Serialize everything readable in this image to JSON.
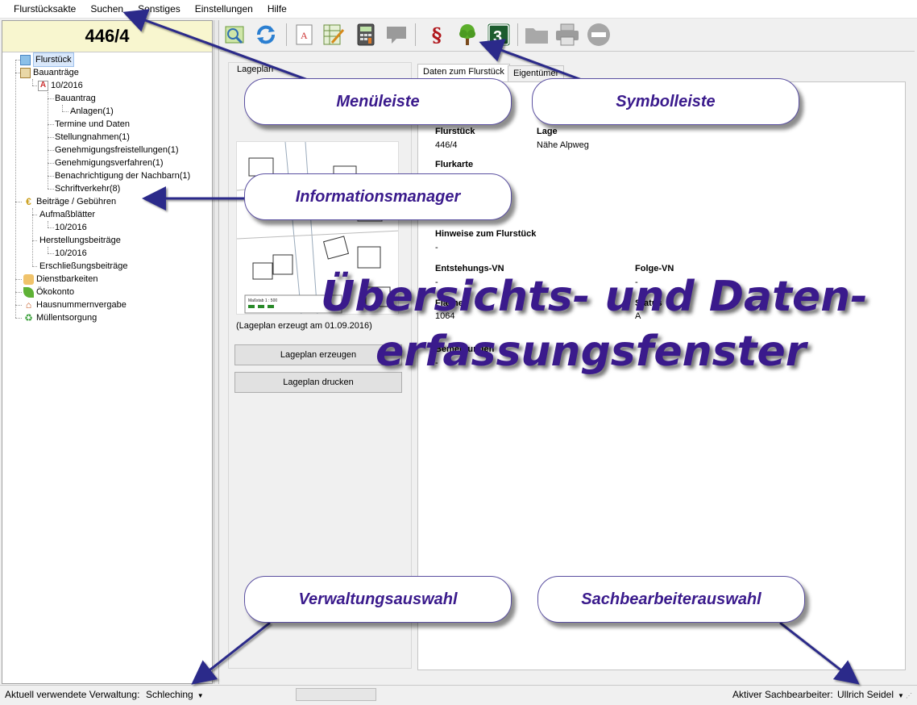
{
  "menu": [
    "Flurstücksakte",
    "Suchen",
    "Sonstiges",
    "Einstellungen",
    "Hilfe"
  ],
  "parcel_number": "446/4",
  "tree": {
    "flurstueck": "Flurstück",
    "bauantraege": "Bauanträge",
    "bauantrag_year": "10/2016",
    "bauantrag": "Bauantrag",
    "anlagen": "Anlagen(1)",
    "termine": "Termine und Daten",
    "stellungnahmen": "Stellungnahmen(1)",
    "freistellungen": "Genehmigungsfreistellungen(1)",
    "verfahren": "Genehmigungsverfahren(1)",
    "nachbarn": "Benachrichtigung der Nachbarn(1)",
    "schriftverkehr": "Schriftverkehr(8)",
    "beitraege": "Beiträge / Gebühren",
    "aufmass": "Aufmaßblätter",
    "aufmass_year": "10/2016",
    "herstellung": "Herstellungsbeiträge",
    "herstellung_year": "10/2016",
    "erschliessung": "Erschließungsbeiträge",
    "dienstbarkeiten": "Dienstbarkeiten",
    "oekokonto": "Ökokonto",
    "hausnummern": "Hausnummernvergabe",
    "muell": "Müllentsorgung"
  },
  "toolbar_icons": [
    "map-search-icon",
    "refresh-icon",
    "document-icon",
    "edit-sheet-icon",
    "calculator-icon",
    "comment-icon",
    "paragraph-icon",
    "tree-icon",
    "number-three-icon",
    "folder-icon",
    "printer-icon",
    "stop-icon"
  ],
  "lageplan": {
    "title": "Lageplan",
    "caption": "(Lageplan erzeugt am 01.09.2016)",
    "btn_create": "Lageplan erzeugen",
    "btn_print": "Lageplan drucken",
    "map_scale": "Maßstab 1 : 500"
  },
  "tabs": [
    "Daten zum Flurstück",
    "Eigentümer"
  ],
  "fields": {
    "flurstueck_label": "Flurstück",
    "flurstueck_value": "446/4",
    "lage_label": "Lage",
    "lage_value": "Nähe Alpweg",
    "flurkarte_label": "Flurkarte",
    "partial_label": "e",
    "hinweise_label": "Hinweise zum Flurstück",
    "hinweise_value": "-",
    "entstehung_label": "Entstehungs-VN",
    "entstehung_value": "-",
    "folge_label": "Folge-VN",
    "folge_value": "-",
    "flaeche_label": "Fläche",
    "flaeche_value": "1064",
    "status_label": "Status",
    "status_value": "A",
    "bemerkungen_label": "Bemerkungen",
    "bemerkungen_value": "-"
  },
  "status": {
    "verwaltung_label": "Aktuell verwendete Verwaltung:",
    "verwaltung_value": "Schleching",
    "sachbearbeiter_label": "Aktiver Sachbearbeiter:",
    "sachbearbeiter_value": "Ullrich Seidel"
  },
  "callouts": {
    "menueleiste": "Menüleiste",
    "symbolleiste": "Symbolleiste",
    "informationsmanager": "Informationsmanager",
    "verwaltungsauswahl": "Verwaltungsauswahl",
    "sachbearbeiterauswahl": "Sachbearbeiterauswahl",
    "overview_line1": "Übersichts- und Daten-",
    "overview_line2": "erfassungsfenster"
  },
  "colors": {
    "callout_text": "#3a1a8c",
    "header_bg": "#f8f6cf",
    "arrow": "#2b2a8a"
  }
}
